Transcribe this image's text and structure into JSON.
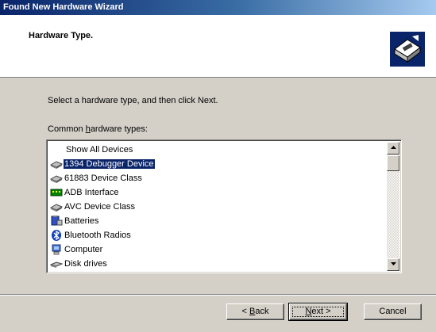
{
  "window": {
    "title": "Found New Hardware Wizard"
  },
  "header": {
    "heading": "Hardware Type.",
    "icon": "hardware-wizard-icon"
  },
  "content": {
    "instruction": "Select a hardware type, and then click Next.",
    "list_label_prefix": "Common ",
    "list_label_accel": "h",
    "list_label_suffix": "ardware types:",
    "items": [
      {
        "label": "Show All Devices",
        "icon": "none"
      },
      {
        "label": "1394 Debugger Device",
        "icon": "device-icon",
        "selected": true
      },
      {
        "label": "61883 Device Class",
        "icon": "device-icon"
      },
      {
        "label": "ADB Interface",
        "icon": "adb-icon"
      },
      {
        "label": "AVC Device Class",
        "icon": "device-icon"
      },
      {
        "label": "Batteries",
        "icon": "battery-icon"
      },
      {
        "label": "Bluetooth Radios",
        "icon": "bluetooth-icon"
      },
      {
        "label": "Computer",
        "icon": "computer-icon"
      },
      {
        "label": "Disk drives",
        "icon": "disk-icon"
      }
    ]
  },
  "buttons": {
    "back_prefix": "< ",
    "back_accel": "B",
    "back_suffix": "ack",
    "next_accel": "N",
    "next_suffix": "ext >",
    "cancel": "Cancel"
  },
  "colors": {
    "selection": "#0a246a",
    "dialog": "#d4d0c8",
    "titlebar_start": "#0a246a",
    "titlebar_end": "#a6caf0"
  }
}
